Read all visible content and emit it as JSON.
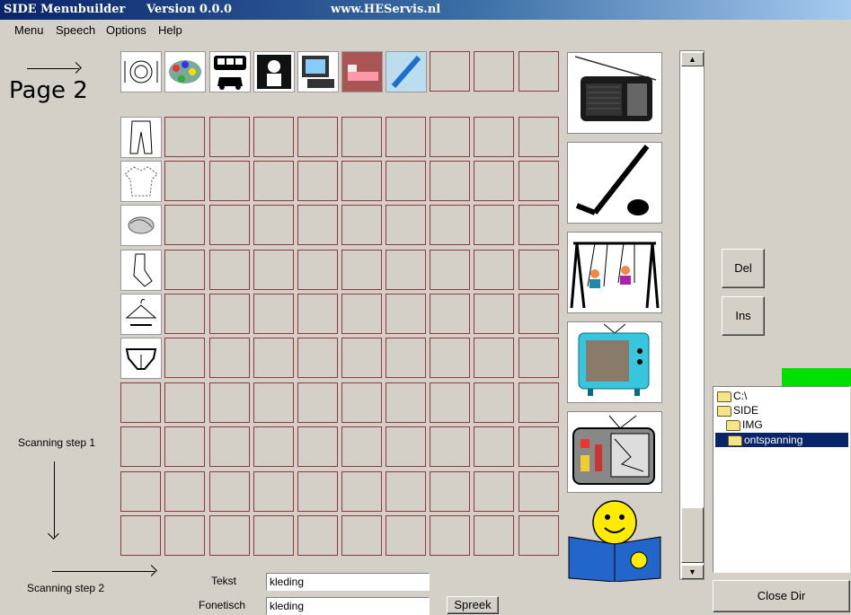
{
  "window": {
    "app_name": "SIDE  Menubuilder",
    "version": "Version 0.0.0",
    "url": "www.HEServis.nl"
  },
  "menu": [
    "Menu",
    "Speech",
    "Options",
    "Help"
  ],
  "page_label": "Page 2",
  "scan_labels": {
    "step1": "Scanning step 1",
    "step2": "Scanning step 2"
  },
  "top_icons": [
    "dining-plate-icon",
    "paint-icon",
    "vehicles-icon",
    "person-portrait-icon",
    "computer-icon",
    "bed-icon",
    "pencil-icon"
  ],
  "row_icons": [
    "trousers-icon",
    "shirt-icon",
    "cloth-icon",
    "socks-icon",
    "hanger-icon",
    "underwear-icon"
  ],
  "side_images": [
    "radio-icon",
    "hockey-icon",
    "swing-icon",
    "tv-icon",
    "broken-tv-icon",
    "reading-smiley-icon"
  ],
  "buttons": {
    "del": "Del",
    "ins": "Ins",
    "close_dir": "Close Dir",
    "spreek": "Spreek"
  },
  "tree": [
    {
      "label": "C:\\",
      "level": 0,
      "selected": false
    },
    {
      "label": "SIDE",
      "level": 0,
      "selected": false
    },
    {
      "label": "IMG",
      "level": 1,
      "selected": false
    },
    {
      "label": "ontspanning",
      "level": 2,
      "selected": true
    }
  ],
  "fields": {
    "tekst_label": "Tekst",
    "tekst_value": "kleding",
    "fonetisch_label": "Fonetisch",
    "fonetisch_value": "kleding"
  },
  "status_color": "#00e000"
}
